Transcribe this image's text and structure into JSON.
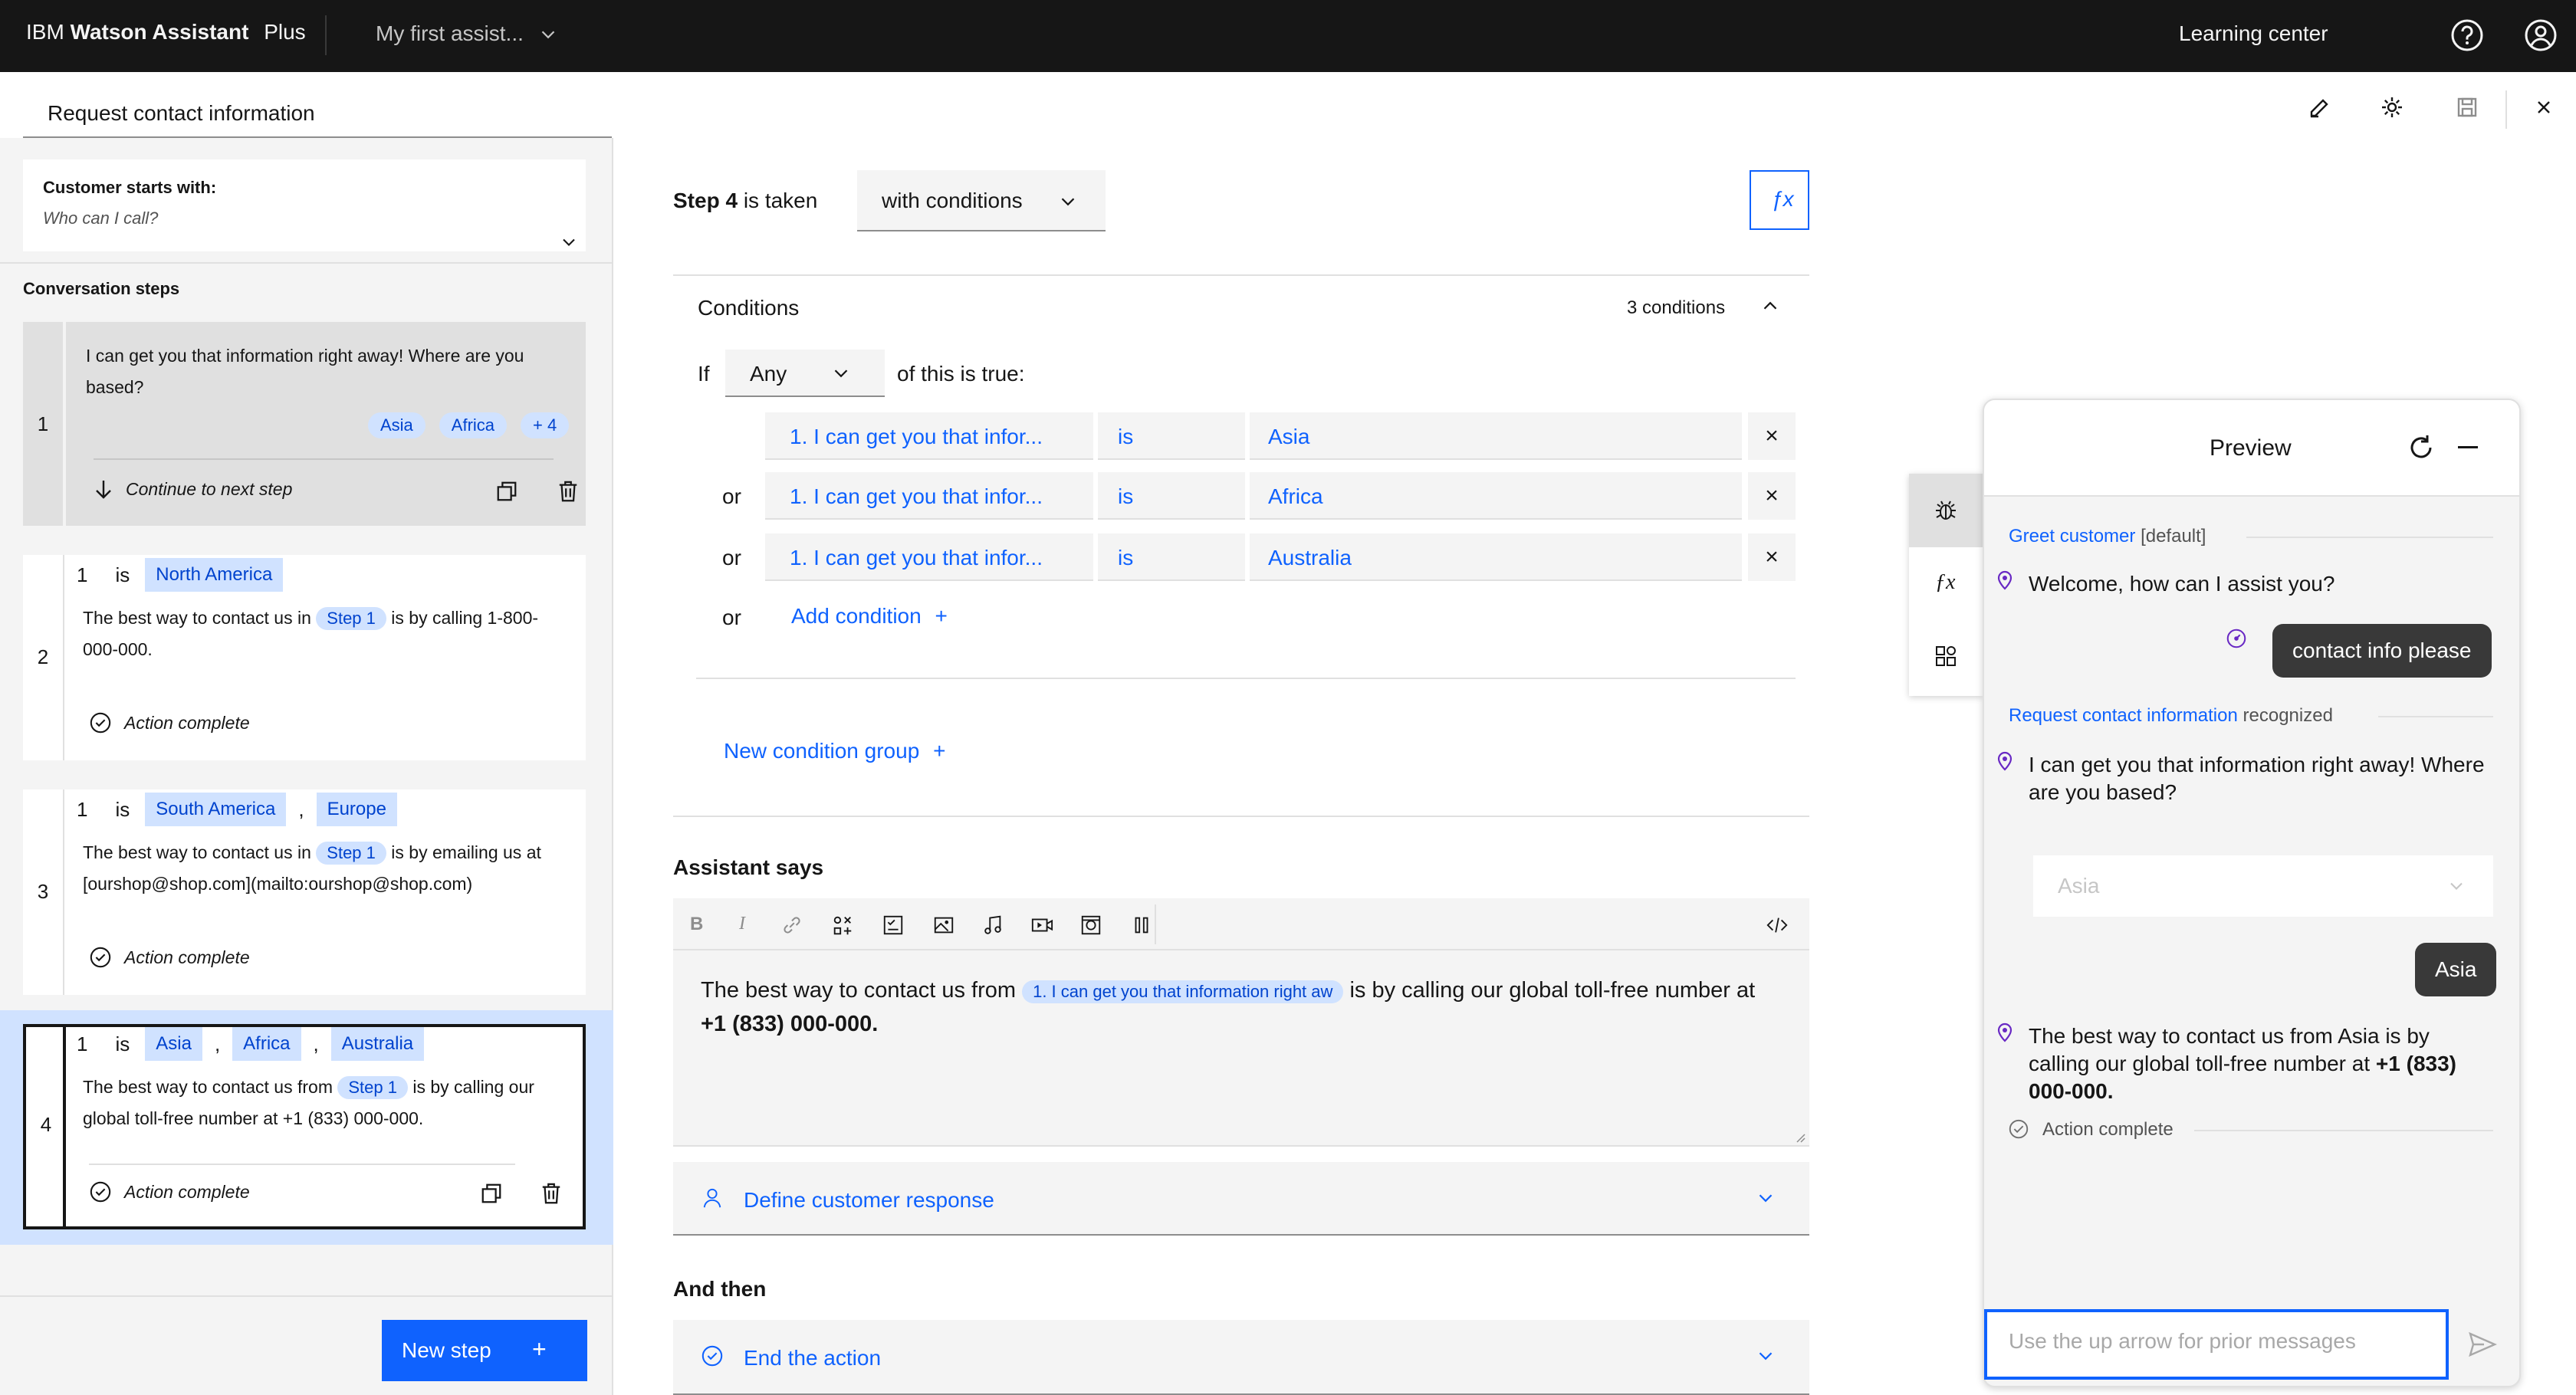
{
  "header": {
    "brand_prefix": "IBM",
    "brand_name": "Watson Assistant",
    "plan": "Plus",
    "assistant_name": "My first assist...",
    "learning_center": "Learning center"
  },
  "action": {
    "title": "Request contact information"
  },
  "left": {
    "starts_with_label": "Customer starts with:",
    "starts_with_value": "Who can I call?",
    "conversation_steps_label": "Conversation steps",
    "new_step_label": "New step",
    "new_step_plus": "+",
    "steps": [
      {
        "num": "1",
        "text": "I can get you that information right away! Where are you based?",
        "tags": [
          "Asia",
          "Africa",
          "+ 4"
        ],
        "footer": "Continue to next step"
      },
      {
        "num": "2",
        "cond_step": "1",
        "cond_is": "is",
        "cond_values": [
          "North America"
        ],
        "text_before": "The best way to contact us in",
        "pill": "Step 1",
        "text_after": "is by calling 1-800-000-000.",
        "footer": "Action complete"
      },
      {
        "num": "3",
        "cond_step": "1",
        "cond_is": "is",
        "cond_values": [
          "South America",
          "Europe"
        ],
        "text_before": "The best way to contact us in",
        "pill": "Step 1",
        "text_after": "is by emailing us at [ourshop@shop.com](mailto:ourshop@shop.com)",
        "footer": "Action complete"
      },
      {
        "num": "4",
        "cond_step": "1",
        "cond_is": "is",
        "cond_values": [
          "Asia",
          "Africa",
          "Australia"
        ],
        "text_before": "The best way to contact us from",
        "pill": "Step 1",
        "text_after": "is by calling our global toll-free number at +1 (833) 000-000.",
        "footer": "Action complete"
      }
    ],
    "comma": ","
  },
  "center": {
    "step_label": "Step 4",
    "is_taken": "is taken",
    "taken_mode": "with conditions",
    "fx": "ƒx",
    "conditions_title": "Conditions",
    "conditions_count": "3 conditions",
    "if_label": "If",
    "any_label": "Any",
    "of_this_true": "of this is true:",
    "conditions": [
      {
        "connector": "",
        "field": "1. I can get you that infor...",
        "op": "is",
        "value": "Asia"
      },
      {
        "connector": "or",
        "field": "1. I can get you that infor...",
        "op": "is",
        "value": "Africa"
      },
      {
        "connector": "or",
        "field": "1. I can get you that infor...",
        "op": "is",
        "value": "Australia"
      }
    ],
    "add_condition_or": "or",
    "add_condition": "Add condition",
    "new_condition_group": "New condition group",
    "plus": "+",
    "remove": "×",
    "assistant_says": "Assistant says",
    "response_before": "The best way to contact us from",
    "response_pill": "1. I can get you that information right aw",
    "response_after": "is by calling our global toll-free number at",
    "response_bold": "+1 (833) 000-000.",
    "define_customer_response": "Define customer response",
    "and_then": "And then",
    "end_the_action": "End the action"
  },
  "preview": {
    "title": "Preview",
    "greet_link": "Greet customer",
    "greet_default": "[default]",
    "welcome": "Welcome, how can I assist you?",
    "user_msg_1": "contact info please",
    "recognized_link": "Request contact information",
    "recognized": "recognized",
    "bot_question": "I can get you that information right away! Where are you based?",
    "dropdown_value": "Asia",
    "user_msg_2": "Asia",
    "bot_answer": "The best way to contact us from Asia is by calling our global toll-free number at",
    "bot_answer_bold": "+1 (833) 000-000.",
    "action_complete": "Action complete",
    "input_placeholder": "Use the up arrow for prior messages"
  },
  "colors": {
    "accent": "#0f62fe",
    "header_bg": "#161616",
    "tag_bg": "#d0e2ff",
    "tag_text": "#0043ce",
    "selected_step_bg": "#d0e2ff",
    "panel_bg": "#f4f4f4"
  }
}
